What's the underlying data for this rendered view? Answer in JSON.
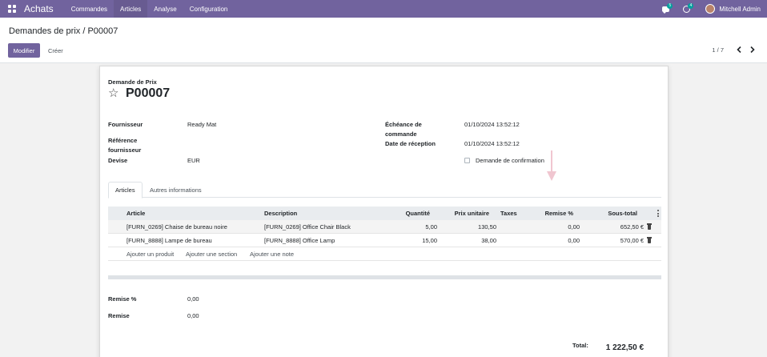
{
  "navbar": {
    "app_name": "Achats",
    "menu": [
      "Commandes",
      "Articles",
      "Analyse",
      "Configuration"
    ],
    "messages_count": "5",
    "activities_count": "4",
    "user_name": "Mitchell Admin",
    "color": "#71639e"
  },
  "control_panel": {
    "breadcrumb_parent": "Demandes de prix",
    "breadcrumb_separator": "/",
    "breadcrumb_current": "P00007",
    "edit_label": "Modifier",
    "create_label": "Créer",
    "pager": "1 / 7",
    "prev_icon": "chevron-left-icon",
    "next_icon": "chevron-right-icon"
  },
  "form": {
    "doc_type": "Demande de Prix",
    "doc_name": "P00007",
    "fields_left": [
      {
        "label": "Fournisseur",
        "value": "Ready Mat"
      },
      {
        "label": "Référence fournisseur",
        "value": ""
      },
      {
        "label": "Devise",
        "value": "EUR"
      }
    ],
    "fields_right": [
      {
        "label": "Échéance de commande",
        "value": "01/10/2024 13:52:12"
      },
      {
        "label": "Date de réception",
        "value": "01/10/2024 13:52:12"
      }
    ],
    "confirmation_label": "Demande de confirmation",
    "confirmation_checked": false,
    "tabs": [
      "Articles",
      "Autres informations"
    ],
    "active_tab": "Articles"
  },
  "lines": {
    "headers": {
      "article": "Article",
      "description": "Description",
      "quantity": "Quantité",
      "unit_price": "Prix unitaire",
      "taxes": "Taxes",
      "discount": "Remise %",
      "subtotal": "Sous-total"
    },
    "rows": [
      {
        "article": "[FURN_0269] Chaise de bureau noire",
        "description": "[FURN_0269] Office Chair Black",
        "quantity": "5,00",
        "unit_price": "130,50",
        "taxes": "",
        "discount": "0,00",
        "subtotal": "652,50 €"
      },
      {
        "article": "[FURN_8888] Lampe de bureau",
        "description": "[FURN_8888] Office Lamp",
        "quantity": "15,00",
        "unit_price": "38,00",
        "taxes": "",
        "discount": "0,00",
        "subtotal": "570,00 €"
      }
    ],
    "add_product": "Ajouter un produit",
    "add_section": "Ajouter une section",
    "add_note": "Ajouter une note"
  },
  "summary": {
    "discount_pct_label": "Remise %",
    "discount_pct_value": "0,00",
    "discount_label": "Remise",
    "discount_value": "0,00",
    "total_label": "Total:",
    "total_value": "1 222,50 €"
  }
}
